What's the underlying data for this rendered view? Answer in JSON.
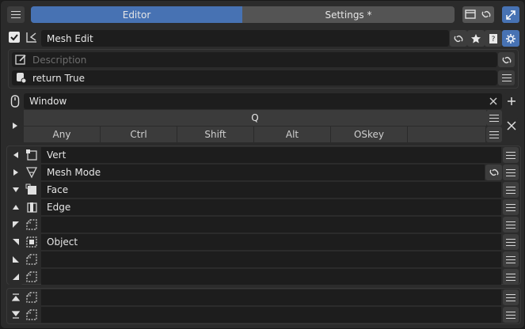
{
  "header": {
    "tabs": [
      {
        "label": "Editor",
        "active": true
      },
      {
        "label": "Settings *",
        "active": false
      }
    ],
    "icons": [
      "menu-icon",
      "window-icon",
      "link-icon",
      "maximize-icon"
    ]
  },
  "item": {
    "enabled": true,
    "name": "Mesh Edit",
    "icons": [
      "link-icon",
      "star-icon",
      "help-icon",
      "settings-icon"
    ]
  },
  "description": {
    "placeholder": "Description"
  },
  "poll": {
    "value": "return True"
  },
  "hotkey": {
    "space": "Window",
    "key": "Q",
    "modifiers": [
      "Any",
      "Ctrl",
      "Shift",
      "Alt",
      "OSkey"
    ]
  },
  "pie_slots": [
    {
      "label": "Vert",
      "direction": "west"
    },
    {
      "label": "Mesh Mode",
      "direction": "east"
    },
    {
      "label": "Face",
      "direction": "south"
    },
    {
      "label": "Edge",
      "direction": "north"
    },
    {
      "label": "",
      "direction": "northwest"
    },
    {
      "label": "Object",
      "direction": "northeast"
    },
    {
      "label": "",
      "direction": "southwest"
    },
    {
      "label": "",
      "direction": "southeast"
    }
  ],
  "extra_slots": [
    {
      "label": "",
      "direction": "top"
    },
    {
      "label": "",
      "direction": "bottom"
    }
  ],
  "colors": {
    "accent": "#4772b3",
    "panel": "#2b2b2b",
    "field": "#1d1d1d",
    "button": "#545454"
  }
}
